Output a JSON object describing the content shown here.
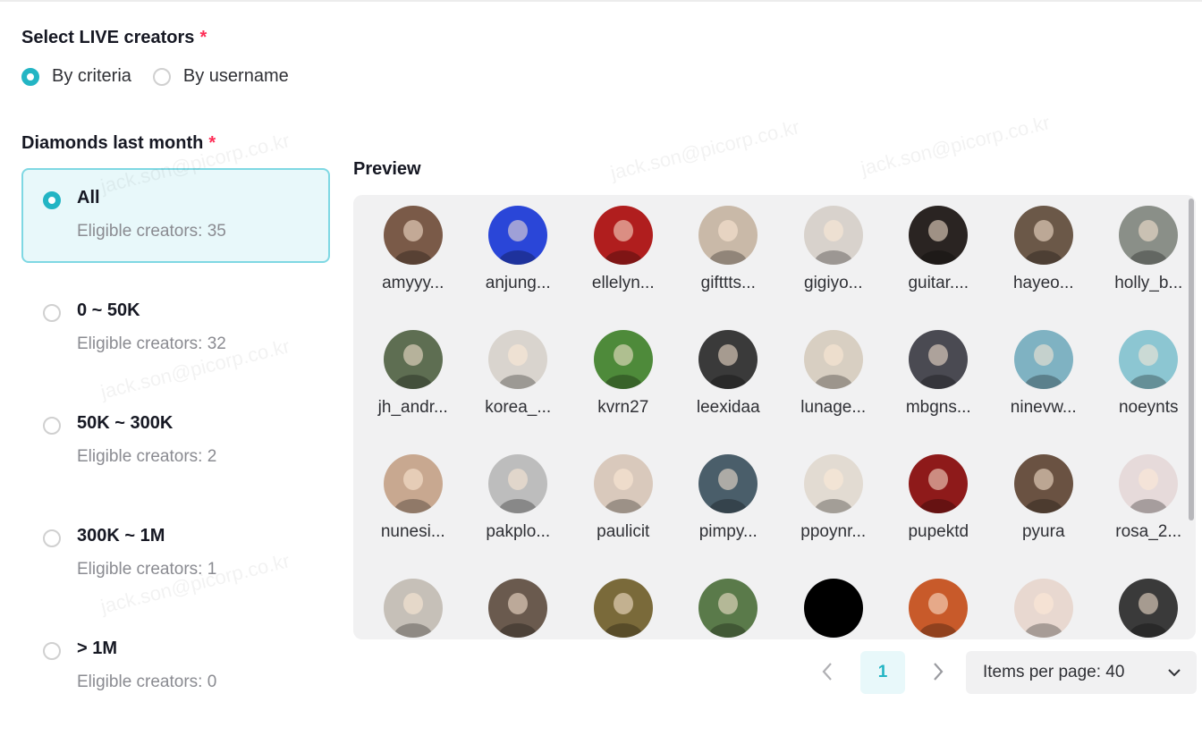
{
  "form": {
    "select_label": "Select LIVE creators",
    "required_mark": "*",
    "modes": [
      {
        "label": "By criteria",
        "checked": true
      },
      {
        "label": "By username",
        "checked": false
      }
    ],
    "diamonds_label": "Diamonds last month"
  },
  "tiers": [
    {
      "name": "All",
      "count": "Eligible creators: 35",
      "selected": true
    },
    {
      "name": "0 ~ 50K",
      "count": "Eligible creators: 32",
      "selected": false
    },
    {
      "name": "50K ~ 300K",
      "count": "Eligible creators: 2",
      "selected": false
    },
    {
      "name": "300K ~ 1M",
      "count": "Eligible creators: 1",
      "selected": false
    },
    {
      "name": "> 1M",
      "count": "Eligible creators: 0",
      "selected": false
    }
  ],
  "preview": {
    "title": "Preview",
    "creators": [
      {
        "name": "amyyy...",
        "color": "#7a5a48"
      },
      {
        "name": "anjung...",
        "color": "#2a46d8"
      },
      {
        "name": "ellelyn...",
        "color": "#b01e1e"
      },
      {
        "name": "gifttts...",
        "color": "#c9b9a8"
      },
      {
        "name": "gigiyo...",
        "color": "#d8d2cc"
      },
      {
        "name": "guitar....",
        "color": "#2a2422"
      },
      {
        "name": "hayeo...",
        "color": "#6b5848"
      },
      {
        "name": "holly_b...",
        "color": "#8a8f88"
      },
      {
        "name": "jh_andr...",
        "color": "#5e6e52"
      },
      {
        "name": "korea_...",
        "color": "#d9d4ce"
      },
      {
        "name": "kvrn27",
        "color": "#4e8a3a"
      },
      {
        "name": "leexidaa",
        "color": "#3a3a3a"
      },
      {
        "name": "lunage...",
        "color": "#d8cfc2"
      },
      {
        "name": "mbgns...",
        "color": "#4a4a52"
      },
      {
        "name": "ninevw...",
        "color": "#7fb2c2"
      },
      {
        "name": "noeynts",
        "color": "#8cc6d2"
      },
      {
        "name": "nunesi...",
        "color": "#c8a890"
      },
      {
        "name": "pakplo...",
        "color": "#bdbdbd"
      },
      {
        "name": "paulicit",
        "color": "#d9c9bc"
      },
      {
        "name": "pimpy...",
        "color": "#4a5e6a"
      },
      {
        "name": "ppoynr...",
        "color": "#e2dbd2"
      },
      {
        "name": "pupektd",
        "color": "#8e1a1a"
      },
      {
        "name": "pyura",
        "color": "#6a5242"
      },
      {
        "name": "rosa_2...",
        "color": "#e6dada"
      },
      {
        "name": "",
        "color": "#c6c0b8"
      },
      {
        "name": "",
        "color": "#6a5a4e"
      },
      {
        "name": "",
        "color": "#7a6a3a"
      },
      {
        "name": "",
        "color": "#5a7a4a"
      },
      {
        "name": "",
        "color": "#000000"
      },
      {
        "name": "",
        "color": "#c85a2a"
      },
      {
        "name": "",
        "color": "#e8d8d0"
      },
      {
        "name": "",
        "color": "#3a3a3a"
      }
    ]
  },
  "pagination": {
    "prev_icon": "chevron-left-icon",
    "current_page": "1",
    "next_icon": "chevron-right-icon",
    "items_per_page_label": "Items per page: 40",
    "dropdown_icon": "chevron-down-icon"
  },
  "colors": {
    "accent": "#23b5c4",
    "selected_bg": "#e8f8fa",
    "required": "#fe2c55"
  },
  "watermark_text": "jack.son@picorp.co.kr"
}
